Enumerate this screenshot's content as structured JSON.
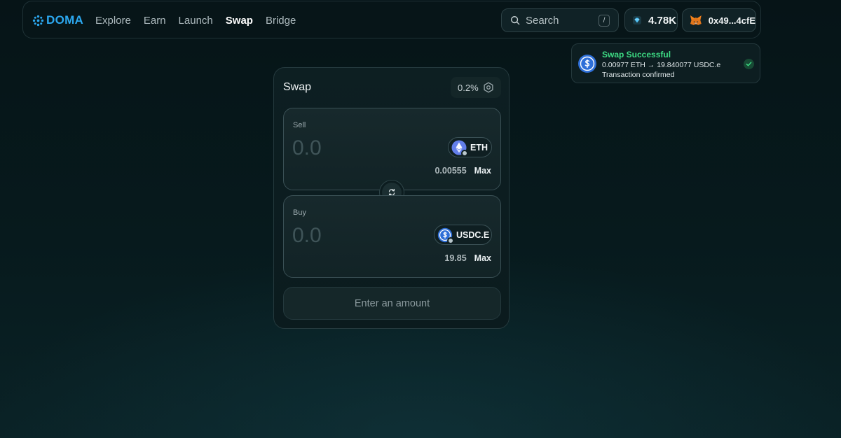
{
  "brand": {
    "name": "DOMA",
    "color": "#2ca8f0"
  },
  "nav": {
    "links": [
      {
        "label": "Explore",
        "active": false
      },
      {
        "label": "Earn",
        "active": false
      },
      {
        "label": "Launch",
        "active": false
      },
      {
        "label": "Swap",
        "active": true
      },
      {
        "label": "Bridge",
        "active": false
      }
    ],
    "search": {
      "placeholder": "Search",
      "shortcut": "/"
    },
    "points": {
      "value": "4.78K",
      "icon": "diamond-icon"
    },
    "wallet": {
      "address": "0x49...4cfE",
      "icon": "metamask-fox-icon"
    }
  },
  "toast": {
    "title": "Swap Successful",
    "detail": "0.00977 ETH → 19.840077 USDC.e",
    "status": "Transaction confirmed",
    "title_color": "#3ddc84"
  },
  "swap": {
    "title": "Swap",
    "slippage": "0.2%",
    "sell": {
      "label": "Sell",
      "placeholder": "0.0",
      "token": "ETH",
      "balance": "0.00555",
      "max_label": "Max"
    },
    "buy": {
      "label": "Buy",
      "placeholder": "0.0",
      "token": "USDC.E",
      "balance": "19.85",
      "max_label": "Max"
    },
    "cta_label": "Enter an amount"
  }
}
